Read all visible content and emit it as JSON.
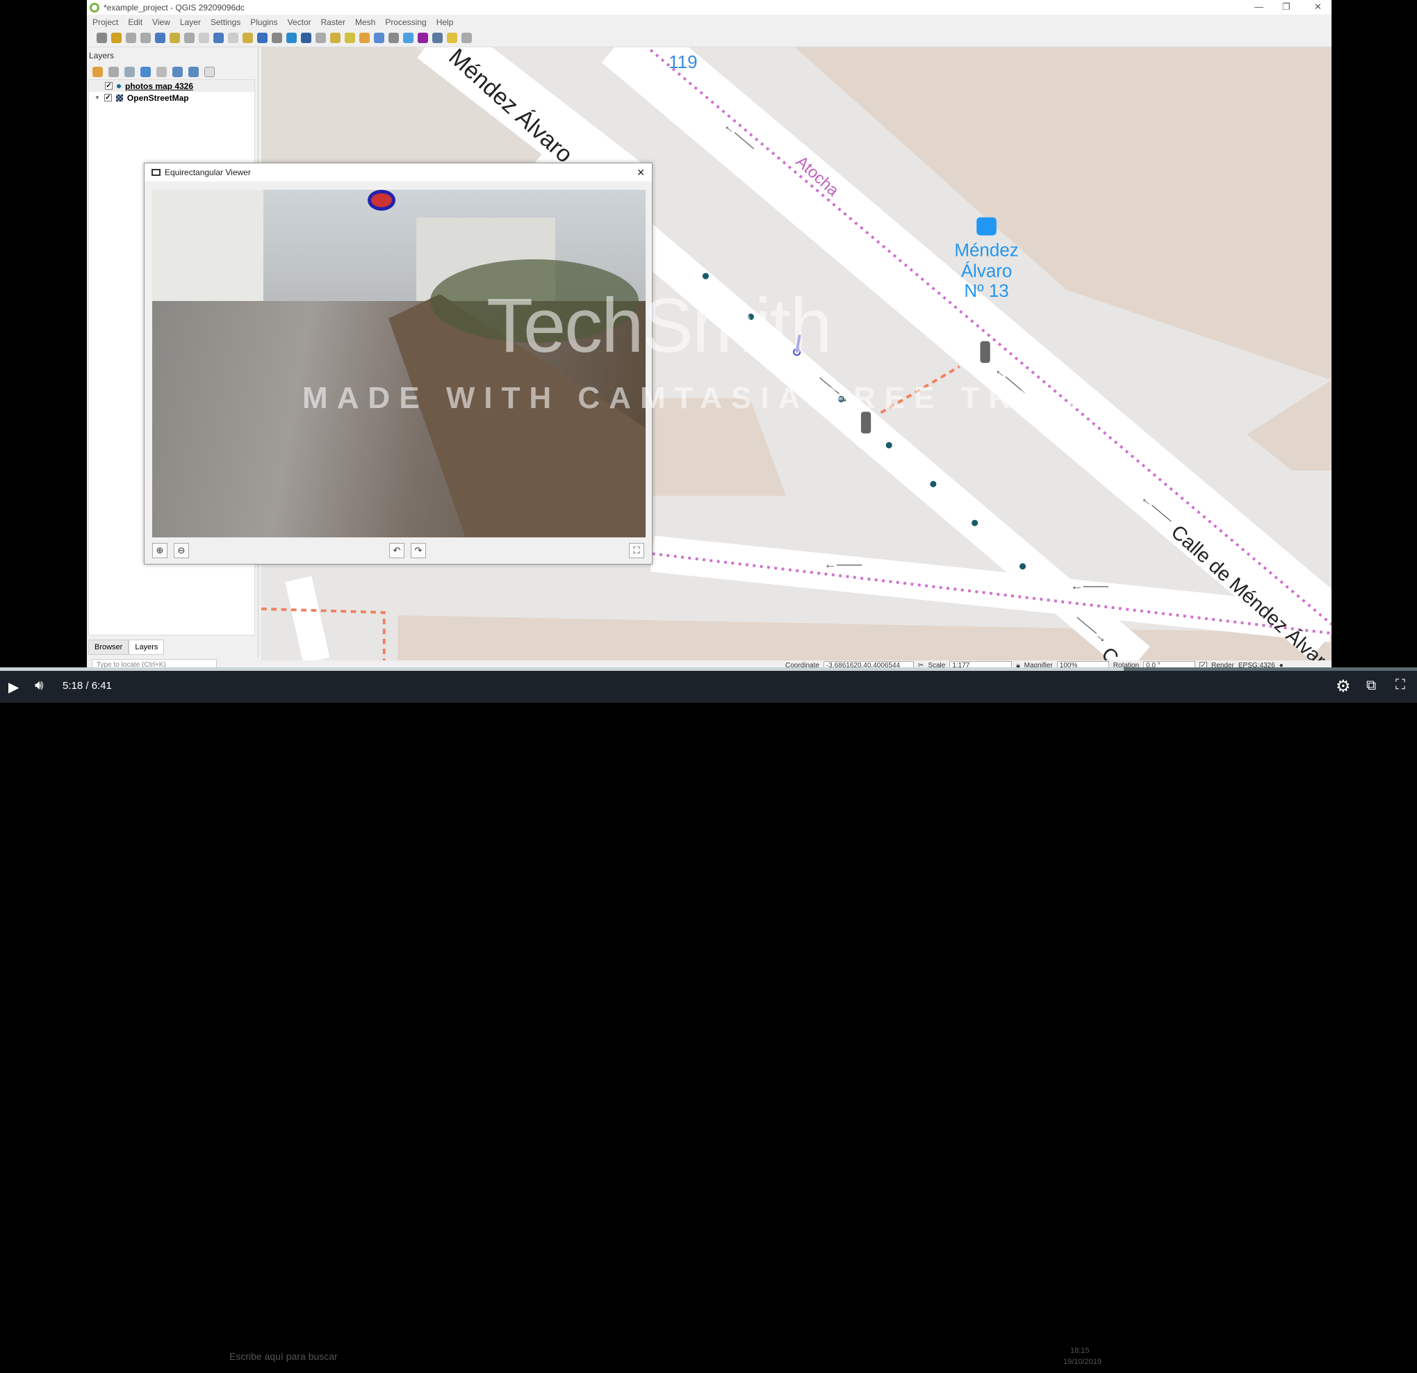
{
  "window": {
    "title": "*example_project - QGIS 29209096dc"
  },
  "menu": [
    "Project",
    "Edit",
    "View",
    "Layer",
    "Settings",
    "Plugins",
    "Vector",
    "Raster",
    "Mesh",
    "Processing",
    "Help"
  ],
  "layers_panel": {
    "title": "Layers",
    "layers": [
      {
        "name": "photos map 4326",
        "checked": true,
        "icon": "point-icon"
      },
      {
        "name": "OpenStreetMap",
        "checked": true,
        "icon": "raster-icon"
      }
    ],
    "tabs": [
      "Browser",
      "Layers"
    ],
    "locate_placeholder": "Type to locate (Ctrl+K)"
  },
  "map": {
    "labels": {
      "road1": "Méndez Álvaro",
      "road2": "Atocha",
      "road3": "Calle de Méndez Álvaro",
      "number": "119",
      "bus_stop": "Méndez",
      "bus_stop2": "Álvaro",
      "bus_stop3": "Nº 13",
      "cut": "C"
    }
  },
  "viewer": {
    "title": "Equirectangular Viewer",
    "buttons": [
      "zoom-in",
      "zoom-out",
      "rotate-left",
      "rotate-right",
      "fullscreen"
    ]
  },
  "statusbar": {
    "coordinate_label": "Coordinate",
    "coordinate": "-3.6861620,40.4006544",
    "scale_label": "Scale",
    "scale": "1:177",
    "magnifier_label": "Magnifier",
    "magnifier": "100%",
    "rotation_label": "Rotation",
    "rotation": "0.0 °",
    "render_label": "Render",
    "render_checked": true,
    "crs": "EPSG:4326"
  },
  "watermark": {
    "brand": "TechSmith",
    "notice": "MADE WITH CAMTASIA FREE TRIAL"
  },
  "player": {
    "time": "5:18 / 6:41",
    "progress": 0.793
  },
  "taskbar": {
    "search_placeholder": "Escribe aquí para buscar",
    "clock_time": "18:15",
    "clock_date": "19/10/2019"
  },
  "colors": {
    "point": "#1a5a6a",
    "bus": "#2196f3",
    "route": "#d070d0"
  }
}
